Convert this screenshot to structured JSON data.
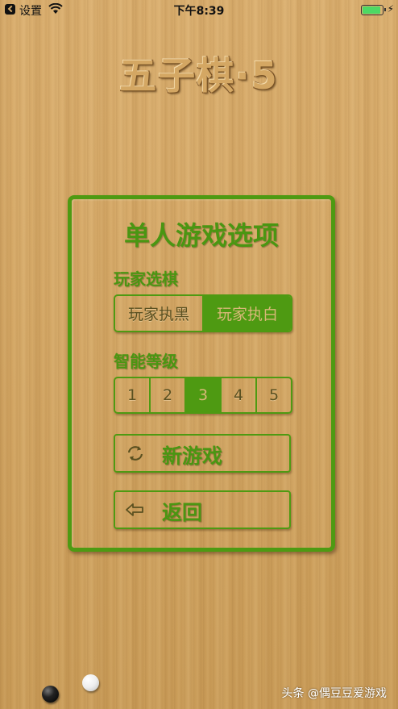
{
  "status_bar": {
    "back_label": "设置",
    "time": "下午8:39",
    "battery_level": 0.9,
    "icons": [
      "back-chevron-icon",
      "wifi-icon",
      "battery-icon",
      "charging-bolt-icon"
    ]
  },
  "game_title": "五子棋·5",
  "panel": {
    "title": "单人游戏选项",
    "player_stone_label": "玩家选棋",
    "player_stone_options": [
      "玩家执黑",
      "玩家执白"
    ],
    "player_stone_selected": "玩家执白",
    "level_label": "智能等级",
    "level_options": [
      "1",
      "2",
      "3",
      "4",
      "5"
    ],
    "level_selected": "3",
    "new_game_label": "新游戏",
    "back_label": "返回"
  },
  "decor": {
    "stones": [
      "black-stone",
      "white-stone"
    ]
  },
  "watermark": "头条 @偶豆豆爱游戏",
  "colors": {
    "accent_green": "#4e9a12",
    "wood": "#d4a765",
    "selected_text": "#d8b878"
  }
}
